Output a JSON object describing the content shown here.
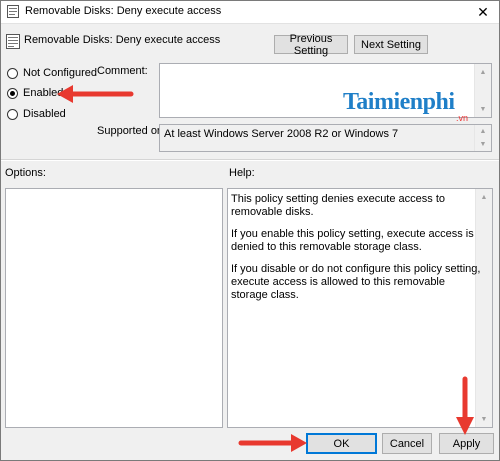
{
  "window": {
    "title": "Removable Disks: Deny execute access",
    "close_glyph": "✕"
  },
  "header": {
    "title": "Removable Disks: Deny execute access",
    "prev_label": "Previous Setting",
    "next_label": "Next Setting"
  },
  "state": {
    "options": [
      {
        "label": "Not Configured",
        "checked": false
      },
      {
        "label": "Enabled",
        "checked": true
      },
      {
        "label": "Disabled",
        "checked": false
      }
    ]
  },
  "comment": {
    "label": "Comment:",
    "value": ""
  },
  "supported": {
    "label": "Supported on:",
    "value": "At least Windows Server 2008 R2 or Windows 7"
  },
  "options_panel": {
    "label": "Options:"
  },
  "help": {
    "label": "Help:",
    "paragraphs": [
      "This policy setting denies execute access to removable disks.",
      "If you enable this policy setting, execute access is denied to this removable storage class.",
      "If you disable or do not configure this policy setting, execute access is allowed to this removable storage class."
    ]
  },
  "footer": {
    "ok_label": "OK",
    "cancel_label": "Cancel",
    "apply_label": "Apply"
  },
  "watermark": {
    "text": "Taimienphi",
    "sub": ".vn"
  },
  "colors": {
    "accent": "#0078d7",
    "arrow": "#e8392f",
    "watermark": "#1f7fc8"
  }
}
